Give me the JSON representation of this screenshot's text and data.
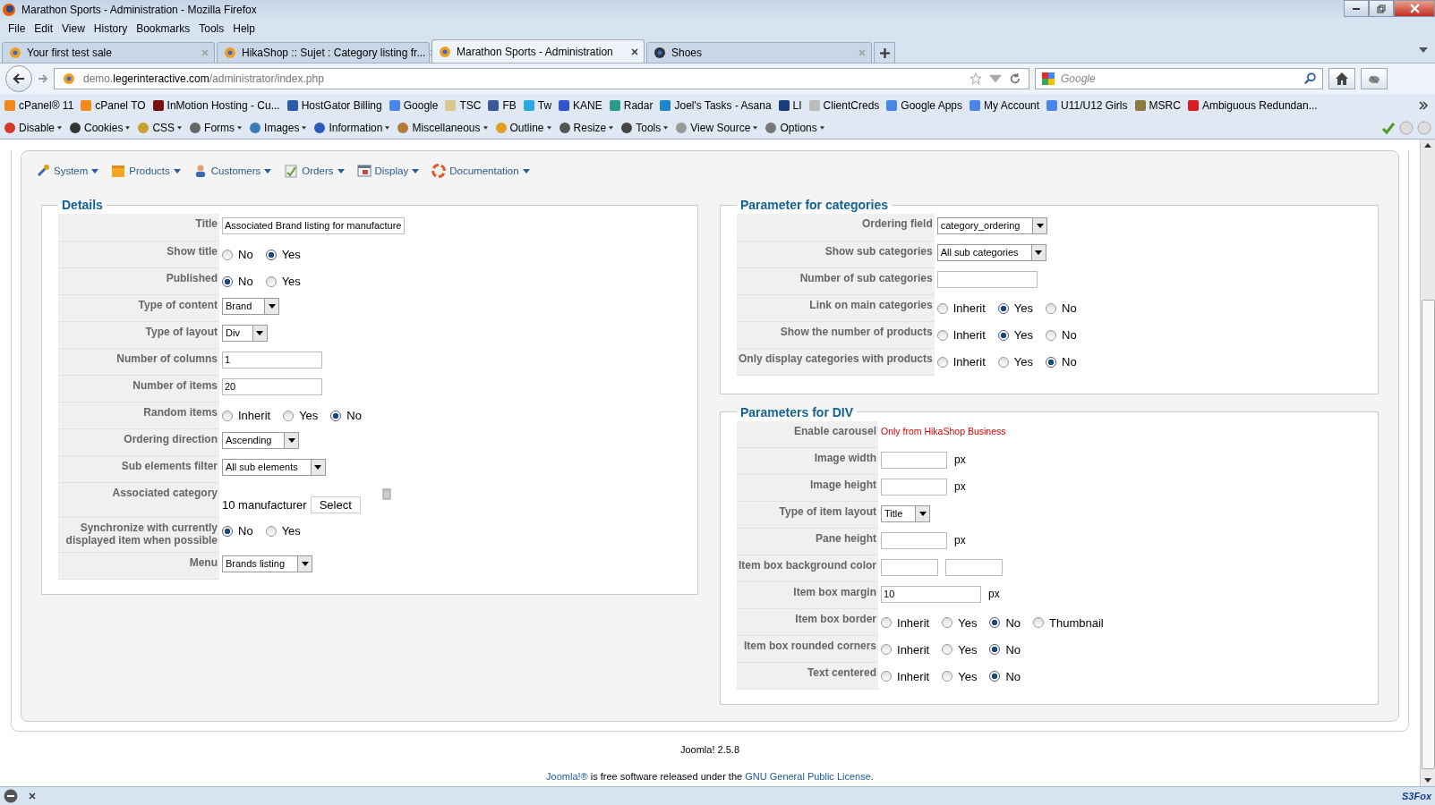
{
  "window": {
    "title": "Marathon Sports - Administration - Mozilla Firefox"
  },
  "menu_bar": [
    "File",
    "Edit",
    "View",
    "History",
    "Bookmarks",
    "Tools",
    "Help"
  ],
  "tabs": [
    {
      "label": "Your first test sale",
      "selected": false
    },
    {
      "label": "HikaShop :: Sujet : Category listing fr...",
      "selected": false
    },
    {
      "label": "Marathon Sports - Administration",
      "selected": true
    },
    {
      "label": "Shoes",
      "selected": false
    }
  ],
  "address_bar": {
    "subdomain": "demo.",
    "domain": "legerinteractive.com",
    "path": "/administrator/index.php"
  },
  "search": {
    "placeholder": "Google"
  },
  "bookmarks": [
    {
      "label": "cPanel® 11",
      "color": "#f08a1c"
    },
    {
      "label": "cPanel TO",
      "color": "#f08a1c"
    },
    {
      "label": "InMotion Hosting - Cu...",
      "color": "#7a1010"
    },
    {
      "label": "HostGator Billing",
      "color": "#2a5caa"
    },
    {
      "label": "Google",
      "color": "#4a86e8"
    },
    {
      "label": "TSC",
      "color": "#d8c890"
    },
    {
      "label": "FB",
      "color": "#3b5998"
    },
    {
      "label": "Tw",
      "color": "#2aa9e0"
    },
    {
      "label": "KANE",
      "color": "#3355cc"
    },
    {
      "label": "Radar",
      "color": "#2a9a8a"
    },
    {
      "label": "Joel's Tasks - Asana",
      "color": "#1a88c8"
    },
    {
      "label": "LI",
      "color": "#1a3c7a"
    },
    {
      "label": "ClientCreds",
      "color": "#bbbbbb"
    },
    {
      "label": "Google Apps",
      "color": "#4a86e8"
    },
    {
      "label": "My Account",
      "color": "#4a86e8"
    },
    {
      "label": "U11/U12 Girls",
      "color": "#4a86e8"
    },
    {
      "label": "MSRC",
      "color": "#8a7a40"
    },
    {
      "label": "Ambiguous Redundan...",
      "color": "#d81e1e"
    }
  ],
  "webdev_toolbar": [
    {
      "label": "Disable",
      "color": "#d23a2a"
    },
    {
      "label": "Cookies",
      "color": "#333333"
    },
    {
      "label": "CSS",
      "color": "#c8a030"
    },
    {
      "label": "Forms",
      "color": "#666666"
    },
    {
      "label": "Images",
      "color": "#3a7ab8"
    },
    {
      "label": "Information",
      "color": "#2a5cb8"
    },
    {
      "label": "Miscellaneous",
      "color": "#b8783a"
    },
    {
      "label": "Outline",
      "color": "#e0a020"
    },
    {
      "label": "Resize",
      "color": "#555555"
    },
    {
      "label": "Tools",
      "color": "#444444"
    },
    {
      "label": "View Source",
      "color": "#999999"
    },
    {
      "label": "Options",
      "color": "#777777"
    }
  ],
  "admin_menu": [
    "System",
    "Products",
    "Customers",
    "Orders",
    "Display",
    "Documentation"
  ],
  "sections": [
    {
      "title": "Details",
      "fields": [
        {
          "kind": "text",
          "label": "Title",
          "value": "Associated Brand listing for manufacture"
        },
        {
          "kind": "radio",
          "label": "Show title",
          "options": [
            {
              "label": "No",
              "selected": false
            },
            {
              "label": "Yes",
              "selected": true
            }
          ]
        },
        {
          "kind": "radio",
          "label": "Published",
          "options": [
            {
              "label": "No",
              "selected": true
            },
            {
              "label": "Yes",
              "selected": false
            }
          ]
        },
        {
          "kind": "select",
          "label": "Type of content",
          "value": "Brand"
        },
        {
          "kind": "select",
          "label": "Type of layout",
          "value": "Div"
        },
        {
          "kind": "text",
          "label": "Number of columns",
          "value": "1"
        },
        {
          "kind": "text",
          "label": "Number of items",
          "value": "20"
        },
        {
          "kind": "radio",
          "label": "Random items",
          "options": [
            {
              "label": "Inherit",
              "selected": false
            },
            {
              "label": "Yes",
              "selected": false
            },
            {
              "label": "No",
              "selected": true
            }
          ]
        },
        {
          "kind": "select",
          "label": "Ordering direction",
          "value": "Ascending"
        },
        {
          "kind": "select",
          "label": "Sub elements filter",
          "value": "All sub elements"
        },
        {
          "kind": "category",
          "label": "Associated category",
          "value": "10 manufacturer",
          "button": "Select"
        },
        {
          "kind": "radio",
          "label": "Synchronize with currently displayed item when possible",
          "options": [
            {
              "label": "No",
              "selected": true
            },
            {
              "label": "Yes",
              "selected": false
            }
          ]
        },
        {
          "kind": "select",
          "label": "Menu",
          "value": "Brands listing"
        }
      ]
    },
    {
      "title": "Parameter for categories",
      "fields": [
        {
          "kind": "select",
          "label": "Ordering field",
          "value": "category_ordering"
        },
        {
          "kind": "select",
          "label": "Show sub categories",
          "value": "All sub categories"
        },
        {
          "kind": "text",
          "label": "Number of sub categories"
        },
        {
          "kind": "radio",
          "label": "Link on main categories",
          "options": [
            {
              "label": "Inherit",
              "selected": false
            },
            {
              "label": "Yes",
              "selected": true
            },
            {
              "label": "No",
              "selected": false
            }
          ]
        },
        {
          "kind": "radio",
          "label": "Show the number of products",
          "options": [
            {
              "label": "Inherit",
              "selected": false
            },
            {
              "label": "Yes",
              "selected": true
            },
            {
              "label": "No",
              "selected": false
            }
          ]
        },
        {
          "kind": "radio",
          "label": "Only display categories with products",
          "options": [
            {
              "label": "Inherit",
              "selected": false
            },
            {
              "label": "Yes",
              "selected": false
            },
            {
              "label": "No",
              "selected": true
            }
          ]
        }
      ]
    },
    {
      "title": "Parameters for DIV",
      "fields": [
        {
          "kind": "note",
          "label": "Enable carousel",
          "text": "Only from HikaShop Business"
        },
        {
          "kind": "text",
          "label": "Image width",
          "unit": "px"
        },
        {
          "kind": "text",
          "label": "Image height",
          "unit": "px"
        },
        {
          "kind": "select",
          "label": "Type of item layout",
          "value": "Title"
        },
        {
          "kind": "text",
          "label": "Pane height",
          "unit": "px"
        },
        {
          "kind": "pair",
          "label": "Item box background color"
        },
        {
          "kind": "text",
          "label": "Item box margin",
          "value": "10",
          "unit": "px"
        },
        {
          "kind": "radio",
          "label": "Item box border",
          "options": [
            {
              "label": "Inherit",
              "selected": false
            },
            {
              "label": "Yes",
              "selected": false
            },
            {
              "label": "No",
              "selected": true
            },
            {
              "label": "Thumbnail",
              "selected": false
            }
          ]
        },
        {
          "kind": "radio",
          "label": "Item box rounded corners",
          "options": [
            {
              "label": "Inherit",
              "selected": false
            },
            {
              "label": "Yes",
              "selected": false
            },
            {
              "label": "No",
              "selected": true
            }
          ]
        },
        {
          "kind": "radio",
          "label": "Text centered",
          "options": [
            {
              "label": "Inherit",
              "selected": false
            },
            {
              "label": "Yes",
              "selected": false
            },
            {
              "label": "No",
              "selected": true
            }
          ]
        }
      ]
    }
  ],
  "footer": {
    "version": "Joomla! 2.5.8",
    "license": [
      {
        "kind": "link",
        "text": "Joomla!®"
      },
      {
        "kind": "text",
        "text": " is free software released under the "
      },
      {
        "kind": "link",
        "text": "GNU General Public License"
      },
      {
        "kind": "text",
        "text": "."
      }
    ]
  },
  "status_bar": {
    "brand": "S3Fox"
  }
}
